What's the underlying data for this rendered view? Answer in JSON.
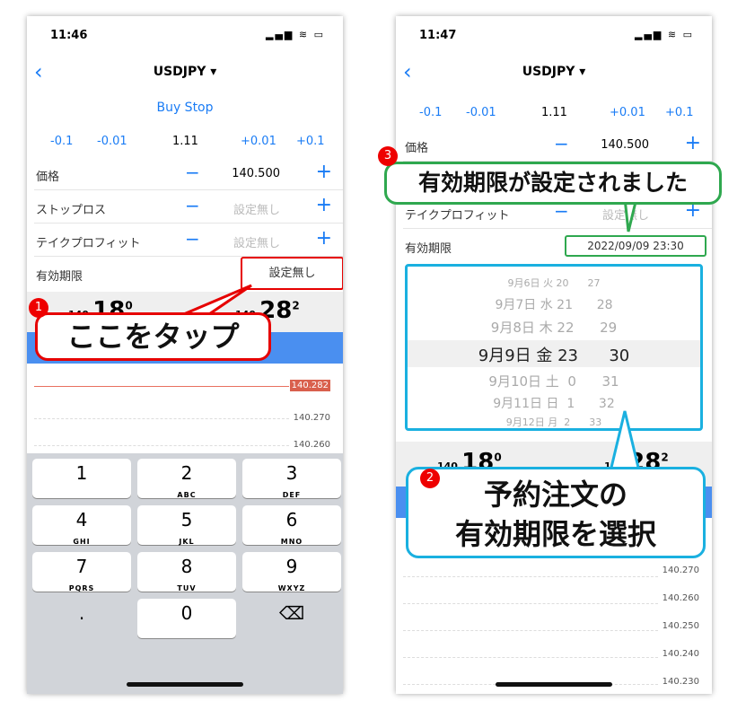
{
  "left": {
    "time": "11:46",
    "status_icons": "▂▄▆ ≋ ▭",
    "title": "USDJPY ▾",
    "order_type": "Buy Stop",
    "steppers": [
      "-0.1",
      "-0.01",
      "1.11",
      "+0.01",
      "+0.1"
    ],
    "rows": [
      {
        "label": "価格",
        "value": "140.500"
      },
      {
        "label": "ストップロス",
        "value": "設定無し"
      },
      {
        "label": "テイクプロフィット",
        "value": "設定無し"
      }
    ],
    "expiry": {
      "label": "有効期限",
      "value": "設定無し"
    },
    "bid": {
      "prefix": "140.",
      "big": "18",
      "sup": "0"
    },
    "ask": {
      "prefix": "140.",
      "big": "28",
      "sup": "2"
    },
    "chart": {
      "current": "140.282",
      "ticks": [
        "140.270",
        "140.260"
      ]
    },
    "keys": [
      {
        "n": "1",
        "l": ""
      },
      {
        "n": "2",
        "l": "ABC"
      },
      {
        "n": "3",
        "l": "DEF"
      },
      {
        "n": "4",
        "l": "GHI"
      },
      {
        "n": "5",
        "l": "JKL"
      },
      {
        "n": "6",
        "l": "MNO"
      },
      {
        "n": "7",
        "l": "PQRS"
      },
      {
        "n": "8",
        "l": "TUV"
      },
      {
        "n": "9",
        "l": "WXYZ"
      },
      {
        "n": ".",
        "l": ""
      },
      {
        "n": "0",
        "l": ""
      },
      {
        "n": "⌫",
        "l": ""
      }
    ],
    "callout": {
      "badge": "1",
      "text": "ここをタップ"
    }
  },
  "right": {
    "time": "11:47",
    "status_icons": "▂▄▆ ≋ ▭",
    "title": "USDJPY ▾",
    "steppers": [
      "-0.1",
      "-0.01",
      "1.11",
      "+0.01",
      "+0.1"
    ],
    "price": {
      "label": "価格",
      "value": "140.500"
    },
    "tp": {
      "label": "テイクプロフィット",
      "value": "設定無し"
    },
    "expiry": {
      "label": "有効期限",
      "value": "2022/09/09 23:30"
    },
    "picker": [
      "9月6日 火 20      27",
      "9月7日 水 21      28",
      "9月8日 木 22      29",
      "9月9日 金 23      30",
      "9月10日 土  0      31",
      "9月11日 日  1      32",
      "9月12日 月  2      33"
    ],
    "bid": {
      "prefix": "140.",
      "big": "18",
      "sup": "0"
    },
    "ask": {
      "prefix": "140.",
      "big": "28",
      "sup": "2"
    },
    "chart": {
      "ticks": [
        "140.270",
        "140.260",
        "140.250",
        "140.240",
        "140.230"
      ]
    },
    "callout3": {
      "badge": "3",
      "text": "有効期限が設定されました"
    },
    "callout2": {
      "badge": "2",
      "line1": "予約注文の",
      "line2": "有効期限を選択"
    }
  },
  "colors": {
    "accent": "#1a7cf5",
    "red": "#e60000",
    "green": "#2fa84f",
    "cyan": "#1ab0e0"
  }
}
